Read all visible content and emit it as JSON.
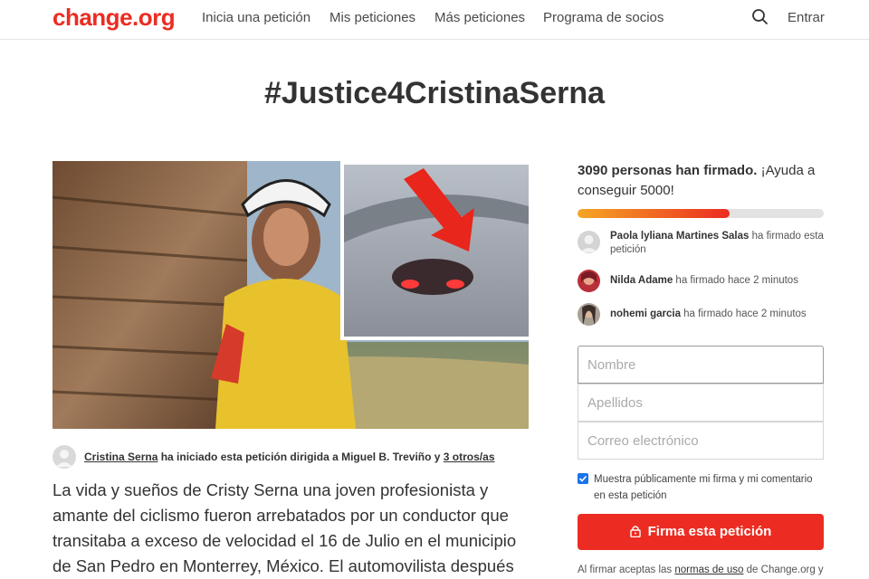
{
  "header": {
    "logo": "change.org",
    "nav": [
      "Inicia una petición",
      "Mis peticiones",
      "Más peticiones",
      "Programa de socios"
    ],
    "signin": "Entrar"
  },
  "petition": {
    "title": "#Justice4CristinaSerna",
    "starter": {
      "name": "Cristina Serna",
      "middle": " ha iniciado esta petición dirigida a ",
      "target": "Miguel B. Treviño",
      "and": " y ",
      "others": "3 otros/as"
    },
    "description": "La vida y sueños de Cristy Serna una joven profesionista y amante del ciclismo fueron arrebatados por un conductor que transitaba a exceso de velocidad el 16 de Julio en el municipio de San Pedro en Monterrey, México. El automovilista después de"
  },
  "signatures": {
    "count_text": "3090 personas han firmado.",
    "goal_text": " ¡Ayuda a conseguir 5000!",
    "count": 3090,
    "goal": 5000,
    "recent": [
      {
        "name": "Paola lyliana Martines Salas",
        "action": " ha firmado esta petición"
      },
      {
        "name": "Nilda Adame",
        "action": " ha firmado hace 2 minutos"
      },
      {
        "name": "nohemi garcia",
        "action": " ha firmado hace 2 minutos"
      }
    ]
  },
  "form": {
    "first_name_placeholder": "Nombre",
    "last_name_placeholder": "Apellidos",
    "email_placeholder": "Correo electrónico",
    "public_label": "Muestra públicamente mi firma y mi comentario en esta petición",
    "sign_label": "Firma esta petición",
    "terms_prefix": "Al firmar aceptas las ",
    "terms_link": "normas de uso",
    "terms_suffix": " de Change.org y"
  },
  "colors": {
    "brand": "#ec2c22",
    "progress_start": "#f5a623",
    "checkbox": "#1a73e8"
  }
}
